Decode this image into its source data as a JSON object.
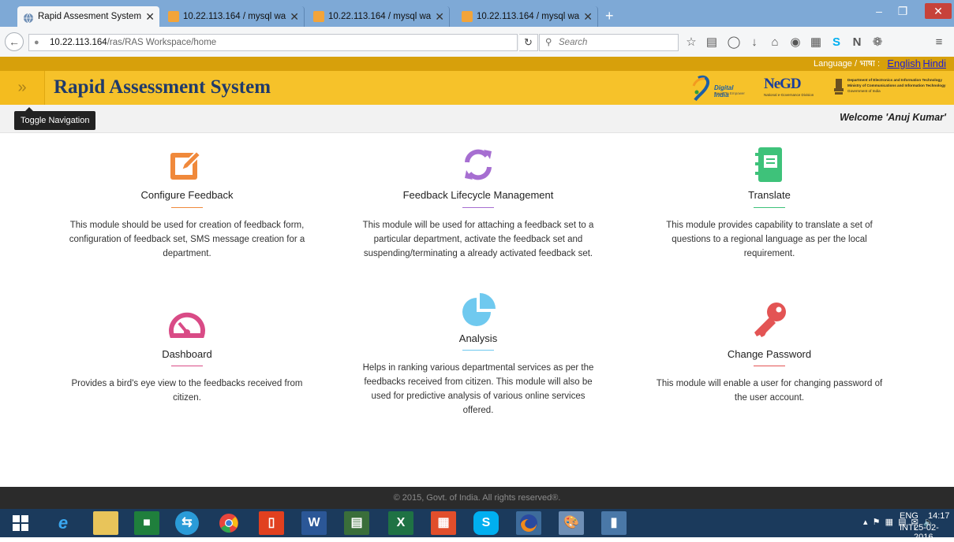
{
  "browser": {
    "tabs": [
      {
        "title": "Rapid Assesment System: ...",
        "active": true
      },
      {
        "title": "10.22.113.164 / mysql wa...",
        "active": false
      },
      {
        "title": "10.22.113.164 / mysql wa...",
        "active": false
      },
      {
        "title": "10.22.113.164 / mysql wa...",
        "active": false
      }
    ],
    "close_glyph": "✕",
    "new_tab": "+",
    "url_host": "10.22.113.164",
    "url_path": "/ras/RAS Workspace/home",
    "search_placeholder": "Search",
    "window": {
      "minimize": "–",
      "maximize": "❐",
      "close": "✕"
    }
  },
  "site": {
    "language_label": "Language / भाषा :",
    "lang_english": "English",
    "lang_hindi": "Hindi",
    "nav_toggle": "»",
    "title": "Rapid Assessment System",
    "toggle_tooltip": "Toggle Navigation",
    "welcome": "Welcome 'Anuj Kumar'",
    "logo_di": {
      "main": "Digital India",
      "sub": "Power To Empower"
    },
    "logo_negd": {
      "main": "NeGD",
      "sub": "National e-Governance Division"
    },
    "logo_deity": {
      "l1": "Department of Electronics and Information Technology",
      "l2": "Ministry of Communications and Information Technology",
      "l3": "Government of India"
    }
  },
  "modules": [
    {
      "title": "Configure Feedback",
      "icon": "edit-icon",
      "color": "#f0893b",
      "desc": [
        "This module should be used for creation of feedback form,",
        "configuration of feedback set, SMS message creation for a",
        "department."
      ]
    },
    {
      "title": "Feedback Lifecycle Management",
      "icon": "refresh-icon",
      "color": "#a66ed1",
      "desc": [
        "This module will be used for attaching a feedback set to a",
        "particular department, activate the feedback set and",
        "suspending/terminating a already activated feedback set."
      ]
    },
    {
      "title": "Translate",
      "icon": "notebook-icon",
      "color": "#3ec27a",
      "desc": [
        "This module provides capability to translate a set of",
        "questions to a regional language as per the local",
        "requirement."
      ]
    },
    {
      "title": "Dashboard",
      "icon": "speedometer-icon",
      "color": "#d94b86",
      "desc": [
        "Provides a bird's eye view to the feedbacks received from",
        "citizen."
      ]
    },
    {
      "title": "Analysis",
      "icon": "pie-chart-icon",
      "color": "#6fc9ef",
      "desc": [
        "Helps in ranking various departmental services as per the",
        "feedbacks received from citizen. This module will also be",
        "used for predictive analysis of various online services",
        "offered."
      ]
    },
    {
      "title": "Change Password",
      "icon": "key-icon",
      "color": "#e35454",
      "desc": [
        "This module will enable a user for changing password of",
        "the user account."
      ]
    }
  ],
  "footer": "© 2015, Govt. of India. All rights reserved®.",
  "taskbar": {
    "lang_top": "ENG",
    "lang_bottom": "INTL",
    "time": "14:17",
    "date": "25-02-2016"
  }
}
